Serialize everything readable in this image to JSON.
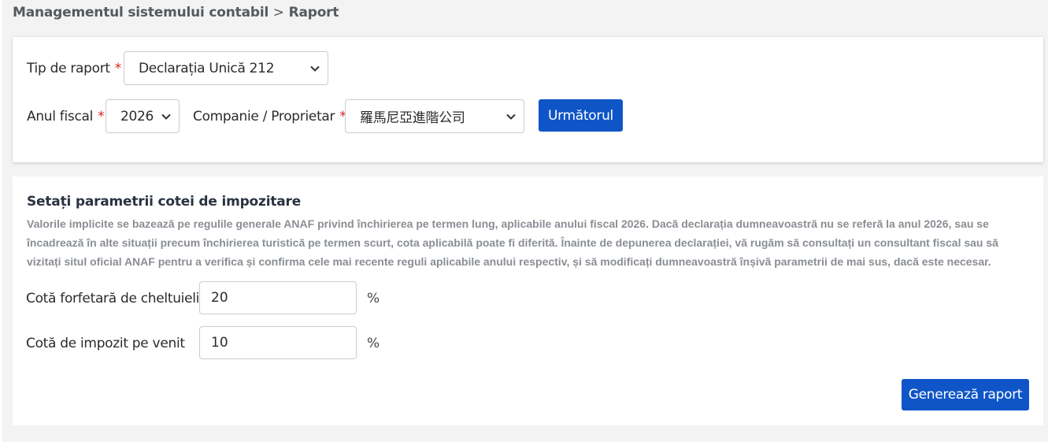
{
  "breadcrumb": {
    "parent": "Managementul sistemului contabil",
    "separator": ">",
    "current": "Raport"
  },
  "report_form": {
    "report_type_label": "Tip de raport",
    "report_type_value": "Declarația Unică 212",
    "fiscal_year_label": "Anul fiscal",
    "fiscal_year_value": "2026",
    "company_label": "Companie / Proprietar",
    "company_value": "羅馬尼亞進階公司",
    "required_marker": "*",
    "next_button": "Următorul"
  },
  "tax_params": {
    "title": "Setați parametrii cotei de impozitare",
    "description": "Valorile implicite se bazează pe regulile generale ANAF privind închirierea pe termen lung, aplicabile anului fiscal 2026. Dacă declarația dumneavoastră nu se referă la anul 2026, sau se încadrează în alte situații precum închirierea turistică pe termen scurt, cota aplicabilă poate fi diferită. Înainte de depunerea declarației, vă rugăm să consultați un consultant fiscal sau să vizitați situl oficial ANAF pentru a verifica și confirma cele mai recente reguli aplicabile anului respectiv, și să modificați dumneavoastră înșivă parametrii de mai sus, dacă este necesar.",
    "expense_rate_label": "Cotă forfetară de cheltuieli",
    "expense_rate_value": "20",
    "income_tax_label": "Cotă de impozit pe venit",
    "income_tax_value": "10",
    "percent_unit": "%",
    "generate_button": "Generează raport"
  },
  "colors": {
    "primary": "#0f55c8",
    "required": "#e02020",
    "page_bg": "#f3f3f4"
  },
  "icons": {
    "select_arrow": "chevron-down-icon"
  }
}
